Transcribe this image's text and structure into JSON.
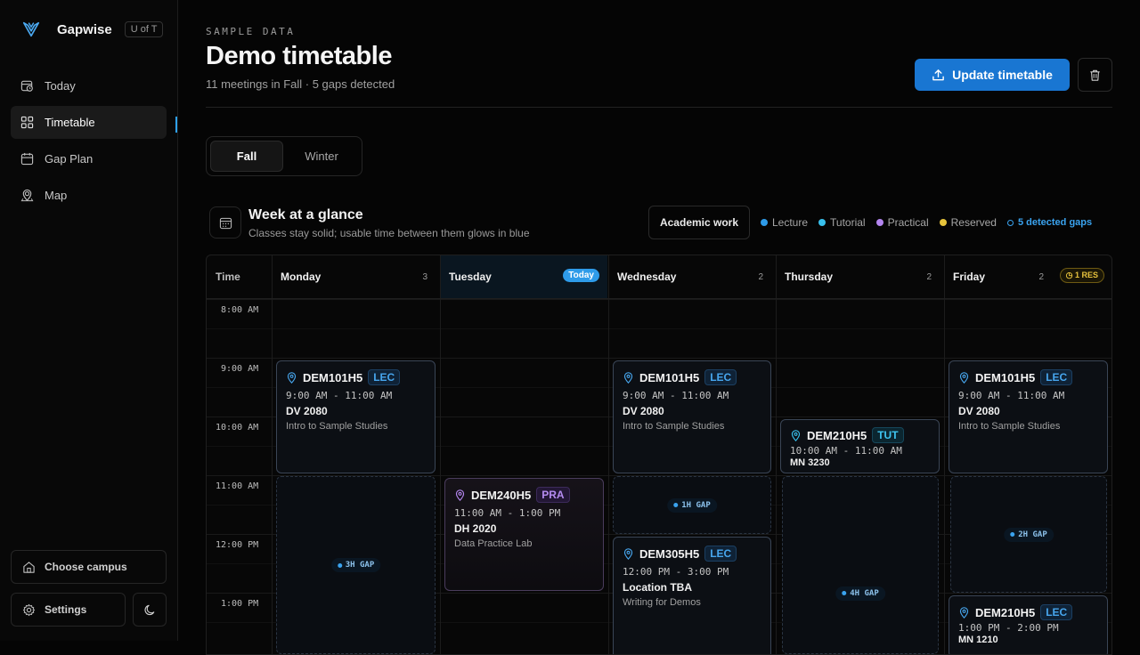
{
  "brand": {
    "name": "Gapwise",
    "badge": "U of T"
  },
  "nav": {
    "items": [
      {
        "label": "Today",
        "icon": "calendar-clock-icon"
      },
      {
        "label": "Timetable",
        "icon": "grid-icon",
        "active": true
      },
      {
        "label": "Gap Plan",
        "icon": "calendar-icon"
      },
      {
        "label": "Map",
        "icon": "map-pin-icon"
      }
    ]
  },
  "sidebar_footer": {
    "campus": "Choose campus",
    "settings": "Settings"
  },
  "header": {
    "eyebrow": "SAMPLE DATA",
    "title": "Demo timetable",
    "subtitle": "11 meetings in Fall · 5 gaps detected",
    "update_label": "Update timetable"
  },
  "terms": {
    "fall": "Fall",
    "winter": "Winter",
    "selected": "Fall"
  },
  "week": {
    "title": "Week at a glance",
    "subtitle": "Classes stay solid; usable time between them glows in blue",
    "academic_label": "Academic work",
    "legend": {
      "lecture": "Lecture",
      "tutorial": "Tutorial",
      "practical": "Practical",
      "reserved": "Reserved",
      "gaps": "5 detected gaps"
    },
    "colors": {
      "lecture": "#2e9be9",
      "tutorial": "#38c0ec",
      "practical": "#b486f0",
      "reserved": "#e6c33b",
      "accent": "#1976d2"
    }
  },
  "calendar": {
    "time_header": "Time",
    "days": [
      {
        "name": "Monday",
        "count": "3"
      },
      {
        "name": "Tuesday",
        "today": "Today"
      },
      {
        "name": "Wednesday",
        "count": "2"
      },
      {
        "name": "Thursday",
        "count": "2"
      },
      {
        "name": "Friday",
        "count": "2",
        "res": "1 RES"
      }
    ],
    "times": [
      "8:00 AM",
      "9:00 AM",
      "10:00 AM",
      "11:00 AM",
      "12:00 PM",
      "1:00 PM"
    ],
    "events": [
      {
        "code": "DEM101H5",
        "type": "LEC",
        "time": "9:00 AM - 11:00 AM",
        "room": "DV 2080",
        "name": "Intro to Sample Studies"
      },
      {
        "code": "DEM240H5",
        "type": "PRA",
        "time": "11:00 AM - 1:00 PM",
        "room": "DH 2020",
        "name": "Data Practice Lab"
      },
      {
        "code": "DEM101H5",
        "type": "LEC",
        "time": "9:00 AM - 11:00 AM",
        "room": "DV 2080",
        "name": "Intro to Sample Studies"
      },
      {
        "code": "DEM305H5",
        "type": "LEC",
        "time": "12:00 PM - 3:00 PM",
        "room": "Location TBA",
        "name": "Writing for Demos"
      },
      {
        "code": "DEM210H5",
        "type": "TUT",
        "time": "10:00 AM - 11:00 AM",
        "room": "MN 3230"
      },
      {
        "code": "DEM101H5",
        "type": "LEC",
        "time": "9:00 AM - 11:00 AM",
        "room": "DV 2080",
        "name": "Intro to Sample Studies"
      },
      {
        "code": "DEM210H5",
        "type": "LEC",
        "time": "1:00 PM - 2:00 PM",
        "room": "MN 1210"
      }
    ],
    "gaps": [
      "3H GAP",
      "1H GAP",
      "4H GAP",
      "2H GAP"
    ]
  }
}
